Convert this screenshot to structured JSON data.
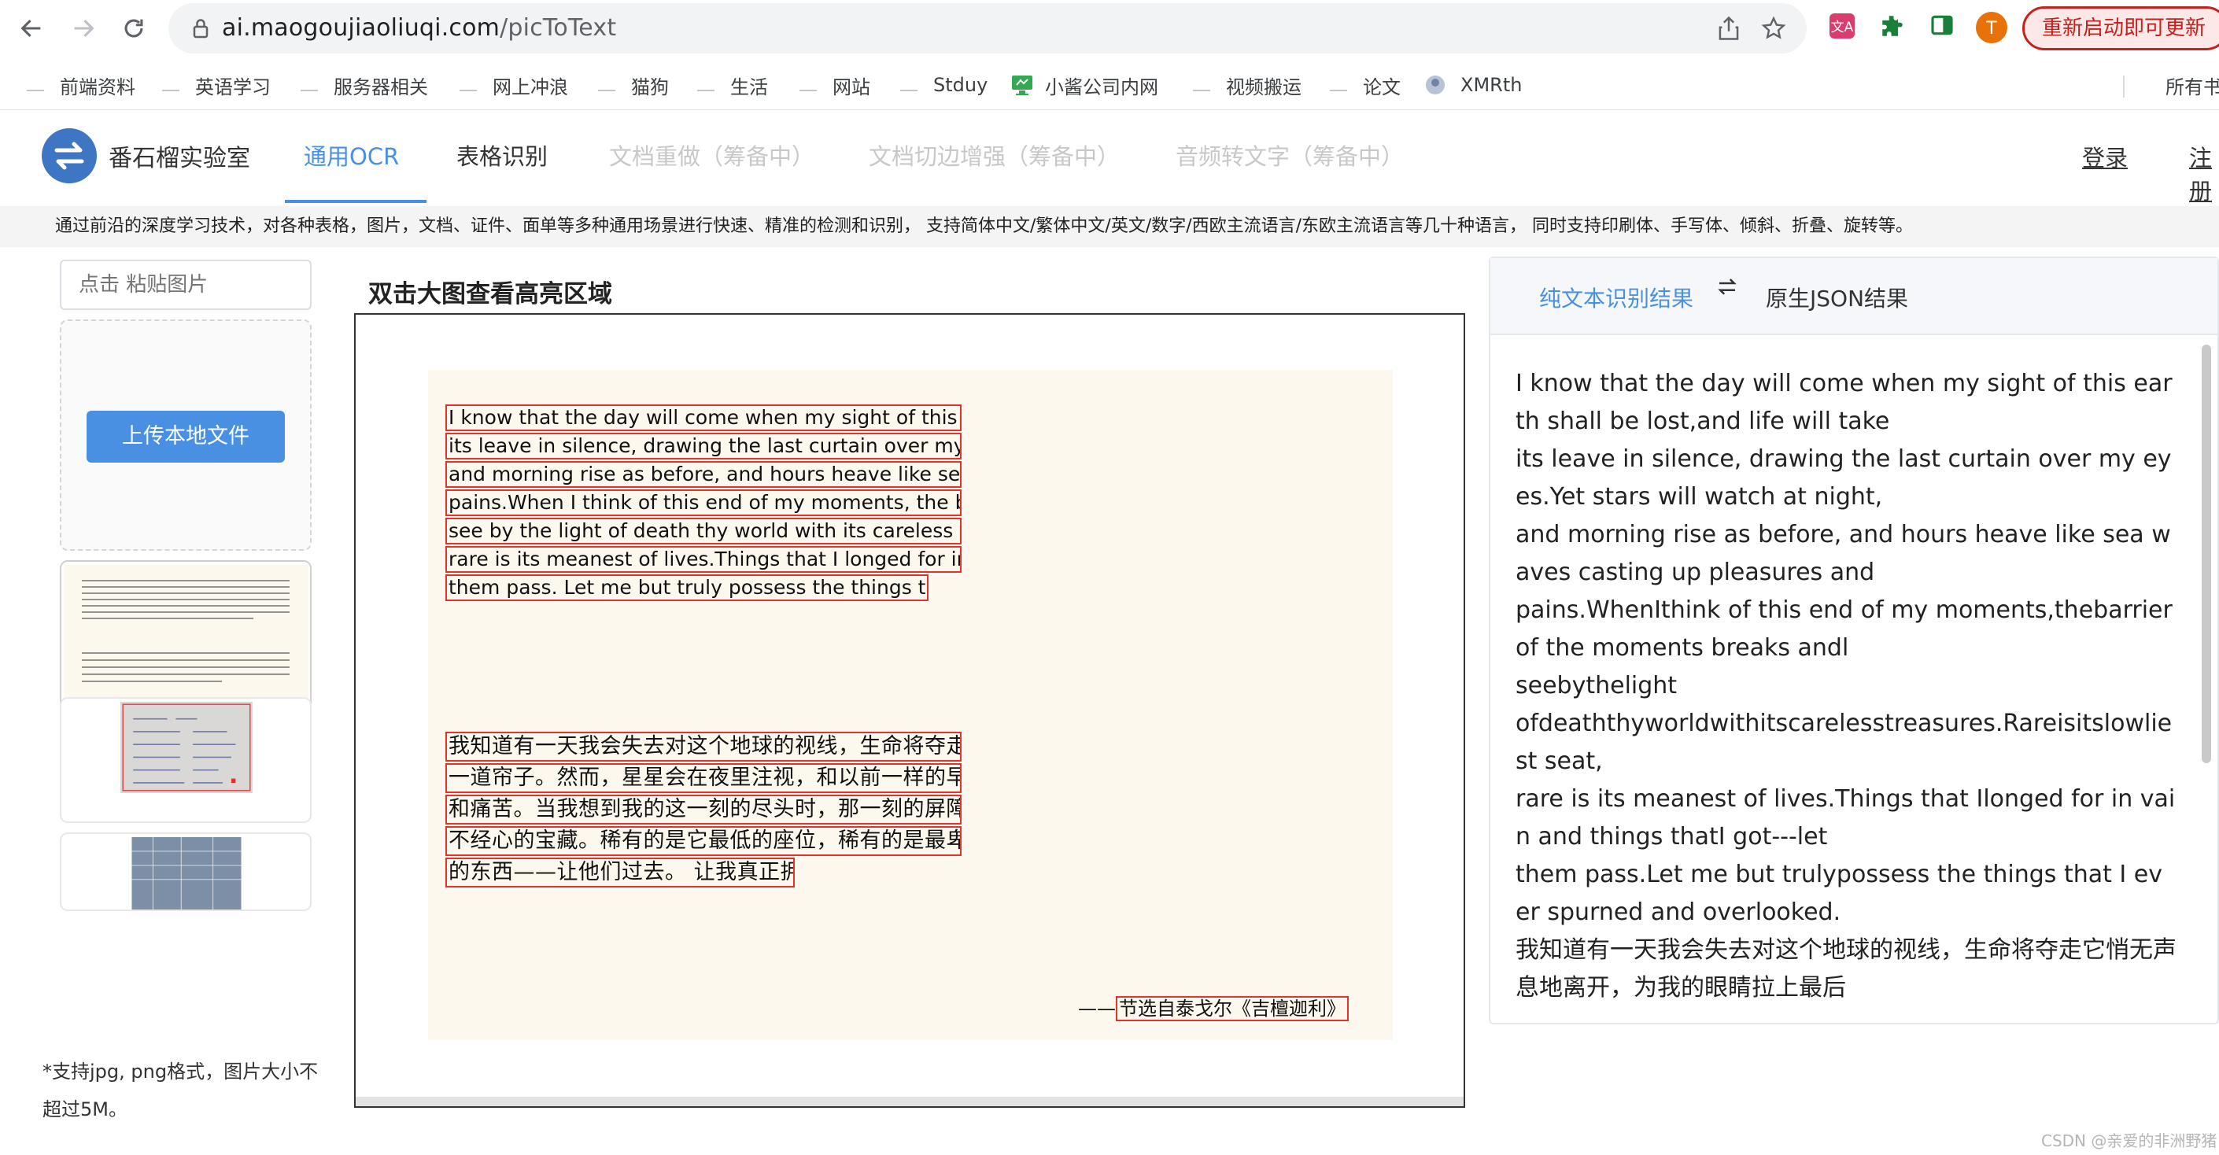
{
  "browser": {
    "url_domain": "ai.maogoujiaoliuqi.com",
    "url_path": "/picToText",
    "relaunch_label": "重新启动即可更新",
    "profile_initial": "T",
    "bookmarks": [
      "前端资料",
      "英语学习",
      "服务器相关",
      "网上冲浪",
      "猫狗",
      "生活",
      "网站",
      "Stduy",
      "小酱公司内网",
      "视频搬运",
      "论文",
      "XMRth",
      "所有书"
    ]
  },
  "site": {
    "name": "番石榴实验室",
    "tabs": [
      {
        "label": "通用OCR",
        "state": "active"
      },
      {
        "label": "表格识别",
        "state": "normal"
      },
      {
        "label": "文档重做（筹备中）",
        "state": "disabled"
      },
      {
        "label": "文档切边增强（筹备中）",
        "state": "disabled"
      },
      {
        "label": "音频转文字（筹备中）",
        "state": "disabled"
      }
    ],
    "login": "登录",
    "register": "注册",
    "description": "通过前沿的深度学习技术，对各种表格，图片，文档、证件、面单等多种通用场景进行快速、精准的检测和识别， 支持简体中文/繁体中文/英文/数字/西欧主流语言/东欧主流语言等几十种语言， 同时支持印刷体、手写体、倾斜、折叠、旋转等。"
  },
  "upload": {
    "paste_placeholder": "点击 粘贴图片",
    "upload_label": "上传本地文件",
    "note": "*支持jpg, png格式，图片大小不超过5M。"
  },
  "preview": {
    "title": "双击大图查看高亮区域",
    "en_lines": [
      "I know that the day will come when my sight of this earth shall be lost, and life will take",
      "its leave in silence, drawing the last curtain over my eyes.Yet stars will watch at night,",
      "and morning rise as before, and hours heave like sea waves casting up pleasures and",
      "pains.When I think of this end of my moments, the barrier of the moments breaks and I",
      "see by the light of death thy world with its careless treasures. Rare is its lowliest seat,",
      "rare is its meanest of lives.Things that I longed for in vain and things that I got---let",
      "them pass. Let me but truly possess the things that I ever spurned and overlooked."
    ],
    "cn_lines": [
      "我知道有一天我会失去对这个地球的视线，生命将夺走它悄无声息地离开，为我的眼睛拉上最后",
      "一道帘子。然而，星星会在夜里注视，和以前一样的早晨升起，时间像海浪一样起伏，带来快乐",
      "和痛苦。当我想到我的这一刻的尽头时，那一刻的屏障打破了，我用死亡之光看你的世界和它漫",
      "不经心的宝藏。稀有的是它最低的座位，稀有的是最卑微的生活。我徒劳地渴望的东西和我得到",
      "的东西——让他们过去。 让我真正拥有我曾经唾弃和忽视的东西。"
    ],
    "attribution_prefix": "——",
    "attribution": "节选自泰戈尔《吉檀迦利》"
  },
  "result": {
    "tab_text": "纯文本识别结果",
    "tab_json": "原生JSON结果",
    "swap_icon": "swap-arrows-icon",
    "lines": [
      "I know that the day will come when my sight of this earth shall be lost,and life will take",
      "its leave in silence, drawing the last curtain over my eyes.Yet stars will watch at night,",
      "and morning rise as before, and hours heave like sea waves casting up pleasures and",
      "pains.WhenIthink of this end of my moments,thebarrierof the moments breaks andl",
      "seebythelight",
      "ofdeaththyworldwithitscarelesstreasures.Rareisitslowliest seat,",
      "rare is its meanest of lives.Things that Ilonged for in vain and things thatI got---let",
      "them pass.Let me but trulypossess the things that I ever spurned and overlooked.",
      "我知道有一天我会失去对这个地球的视线，生命将夺走它悄无声息地离开，为我的眼睛拉上最后"
    ]
  },
  "watermark": "CSDN @亲爱的非洲野猪",
  "colors": {
    "accent": "#4a90e2",
    "ocr_box": "#e0342c",
    "relaunch": "#c5221f"
  }
}
